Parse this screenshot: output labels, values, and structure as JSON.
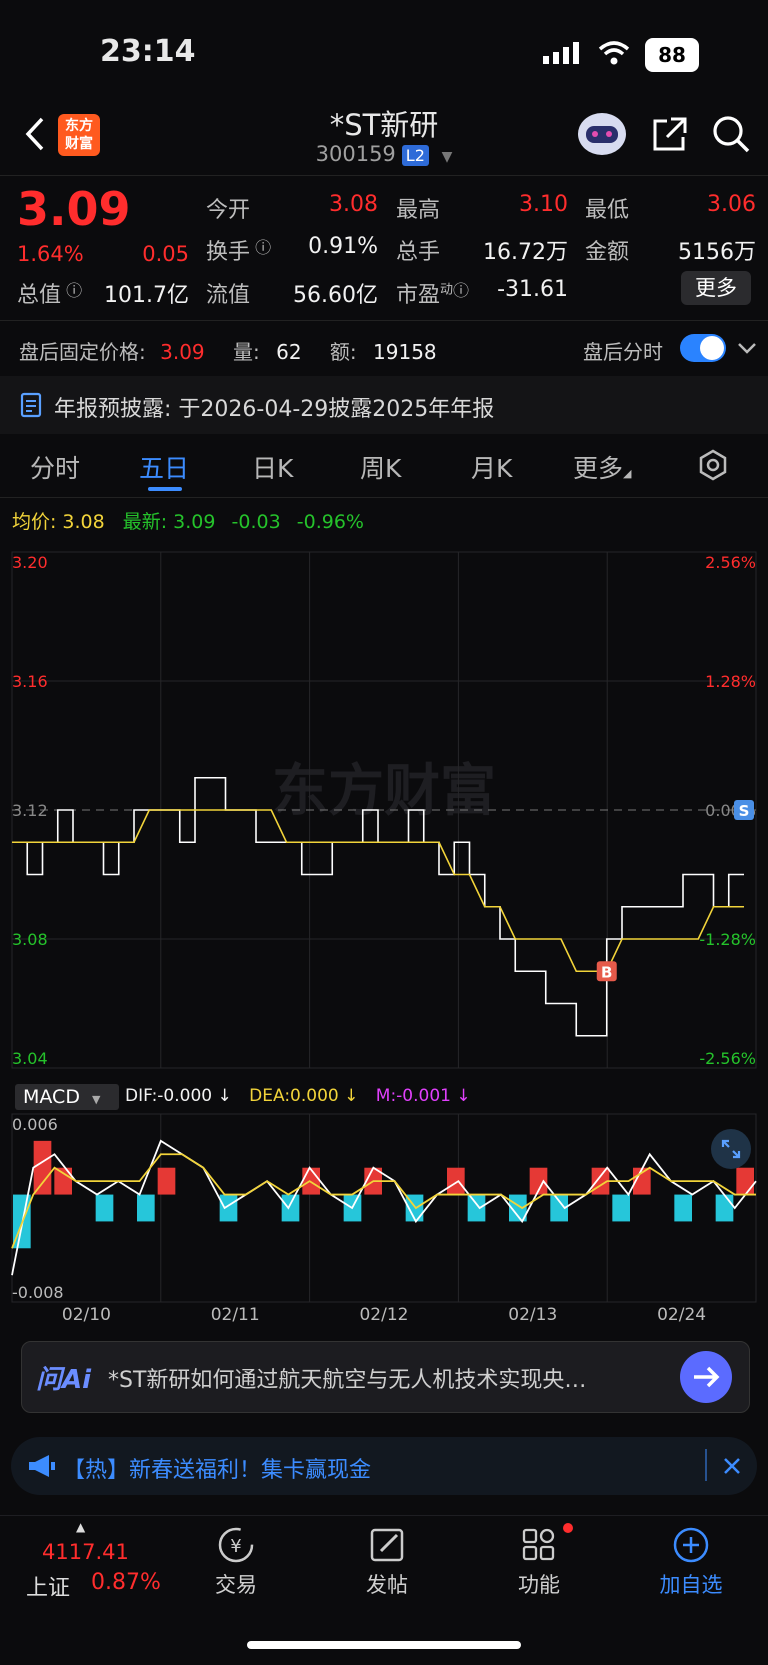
{
  "status": {
    "time": "23:14",
    "battery": "88"
  },
  "header": {
    "logo_line1": "东方",
    "logo_line2": "财富",
    "title": "*ST新研",
    "code": "300159",
    "level": "L2"
  },
  "quote": {
    "price": "3.09",
    "change_pct": "1.64%",
    "change": "0.05",
    "fields": [
      {
        "label": "今开",
        "value": "3.08"
      },
      {
        "label": "最高",
        "value": "3.10"
      },
      {
        "label": "最低",
        "value": "3.06"
      },
      {
        "label": "换手",
        "value": "0.91%"
      },
      {
        "label": "总手",
        "value": "16.72万"
      },
      {
        "label": "金额",
        "value": "5156万"
      },
      {
        "label": "总值",
        "value": "101.7亿"
      },
      {
        "label": "流值",
        "value": "56.60亿"
      },
      {
        "label": "市盈",
        "value": "-31.61"
      }
    ],
    "pe_sup": "动",
    "more": "更多"
  },
  "afterhours": {
    "price_label": "盘后固定价格:",
    "price": "3.09",
    "vol_label": "量:",
    "vol": "62",
    "amount_label": "额:",
    "amount": "19158",
    "toggle_label": "盘后分时"
  },
  "announcement": {
    "label": "年报预披露:",
    "text": "于2026-04-29披露2025年年报"
  },
  "tabs": [
    "分时",
    "五日",
    "日K",
    "周K",
    "月K",
    "更多"
  ],
  "summary": {
    "avg_label": "均价:",
    "avg": "3.08",
    "latest_label": "最新:",
    "latest": "3.09",
    "chg": "-0.03",
    "chg_pct": "-0.96%"
  },
  "chart_data": {
    "type": "line",
    "title": "",
    "y_left_ticks": [
      "3.20",
      "3.16",
      "3.12",
      "3.08",
      "3.04"
    ],
    "y_right_ticks": [
      "2.56%",
      "1.28%",
      "0.00%",
      "-1.28%",
      "-2.56%"
    ],
    "ylim": [
      3.04,
      3.2
    ],
    "x_labels": [
      "02/10",
      "02/11",
      "02/12",
      "02/13",
      "02/24"
    ],
    "series": [
      {
        "name": "",
        "color": "#ffffff",
        "values": [
          3.11,
          3.1,
          3.11,
          3.12,
          3.11,
          3.11,
          3.1,
          3.11,
          3.12,
          3.12,
          3.12,
          3.11,
          3.13,
          3.13,
          3.12,
          3.12,
          3.11,
          3.11,
          3.11,
          3.1,
          3.1,
          3.11,
          3.11,
          3.12,
          3.11,
          3.11,
          3.12,
          3.11,
          3.1,
          3.11,
          3.1,
          3.09,
          3.08,
          3.07,
          3.07,
          3.06,
          3.06,
          3.05,
          3.05,
          3.08,
          3.09,
          3.09,
          3.09,
          3.09,
          3.1,
          3.1,
          3.09,
          3.1,
          3.1
        ]
      },
      {
        "name": "",
        "color": "#f2d43a",
        "values": [
          3.11,
          3.11,
          3.11,
          3.11,
          3.11,
          3.11,
          3.11,
          3.11,
          3.11,
          3.12,
          3.12,
          3.12,
          3.12,
          3.12,
          3.12,
          3.12,
          3.12,
          3.12,
          3.11,
          3.11,
          3.11,
          3.11,
          3.11,
          3.11,
          3.11,
          3.11,
          3.11,
          3.11,
          3.11,
          3.1,
          3.1,
          3.09,
          3.09,
          3.08,
          3.08,
          3.08,
          3.08,
          3.07,
          3.07,
          3.07,
          3.08,
          3.08,
          3.08,
          3.08,
          3.08,
          3.08,
          3.09,
          3.09,
          3.09
        ]
      }
    ],
    "markers": [
      {
        "label": "B",
        "value": 3.07
      },
      {
        "label": "S",
        "value": 3.12
      }
    ],
    "watermark": "东方财富",
    "indicator": {
      "name": "MACD",
      "dif": "DIF:-0.000",
      "dea": "DEA:0.000",
      "m": "M:-0.001",
      "ylim": [
        -0.008,
        0.006
      ],
      "y_ticks": [
        "0.006",
        "-0.008"
      ],
      "dif_values": [
        -0.006,
        0.002,
        0.003,
        0.001,
        0.0,
        0.001,
        0.0,
        0.004,
        0.003,
        0.002,
        -0.001,
        0.0,
        0.001,
        -0.001,
        0.002,
        0.0,
        -0.001,
        0.002,
        0.001,
        -0.002,
        0.0,
        0.001,
        -0.001,
        0.0,
        -0.002,
        0.001,
        -0.001,
        0.0,
        0.002,
        0.0,
        0.003,
        0.001,
        0.0,
        0.001,
        -0.001,
        0.001
      ],
      "dea_values": [
        -0.004,
        0.0,
        0.002,
        0.001,
        0.001,
        0.001,
        0.001,
        0.003,
        0.003,
        0.002,
        0.0,
        0.0,
        0.001,
        0.0,
        0.001,
        0.0,
        0.0,
        0.001,
        0.001,
        -0.001,
        0.0,
        0.0,
        0.0,
        0.0,
        -0.001,
        0.0,
        0.0,
        0.0,
        0.001,
        0.001,
        0.002,
        0.001,
        0.001,
        0.001,
        0.0,
        0.0
      ],
      "m_values": [
        -0.004,
        0.004,
        0.002,
        0.0,
        -0.002,
        0.0,
        -0.002,
        0.002,
        0.0,
        0.0,
        -0.002,
        0.0,
        0.0,
        -0.002,
        0.002,
        0.0,
        -0.002,
        0.002,
        0.0,
        -0.002,
        0.0,
        0.002,
        -0.002,
        0.0,
        -0.002,
        0.002,
        -0.002,
        0.0,
        0.002,
        -0.002,
        0.002,
        0.0,
        -0.002,
        0.0,
        -0.002,
        0.002
      ]
    }
  },
  "ask_ai": {
    "logo": "问Ai",
    "prompt": "*ST新研如何通过航天航空与无人机技术实现央…"
  },
  "notice": {
    "tag": "【热】",
    "text": "新春送福利！集卡赢现金"
  },
  "bottom_nav": {
    "index_value": "4117.41",
    "index_name": "上证",
    "index_pct": "0.87%",
    "items": [
      "交易",
      "发帖",
      "功能",
      "加自选"
    ]
  },
  "colors": {
    "up": "#ff2d2d",
    "down": "#25c22b",
    "accent": "#3c8cff",
    "avg": "#f2d43a",
    "macd_pos": "#e53935",
    "macd_neg": "#26c6da"
  }
}
